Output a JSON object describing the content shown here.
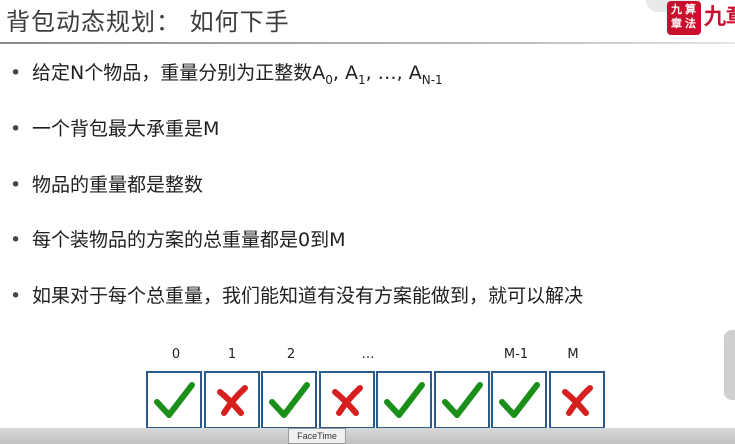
{
  "slide": {
    "title": "背包动态规划： 如何下手",
    "logo": {
      "seal_chars": [
        "算",
        "法",
        "九",
        "章"
      ],
      "brush_text": "九章"
    },
    "bullets": [
      {
        "text": "给定N个物品，重量分别为正整数A",
        "s1": "0",
        "m1": ", A",
        "s2": "1",
        "m2": ", …, A",
        "s3": "N-1"
      },
      {
        "text": "一个背包最大承重是M"
      },
      {
        "text": "物品的重量都是整数"
      },
      {
        "text": "每个装物品的方案的总重量都是0到M"
      },
      {
        "text": "如果对于每个总重量，我们能知道有没有方案能做到，就可以解决"
      }
    ],
    "array_labels": [
      "0",
      "1",
      "2",
      "…",
      "M-1",
      "M"
    ],
    "cells": [
      "check",
      "cross",
      "check",
      "cross",
      "check",
      "check",
      "check",
      "cross"
    ],
    "colors": {
      "check": "#1a8f1a",
      "cross": "#d61f1f",
      "border": "#2b5a8c"
    }
  },
  "taskbar": {
    "facetime_label": "FaceTime"
  }
}
